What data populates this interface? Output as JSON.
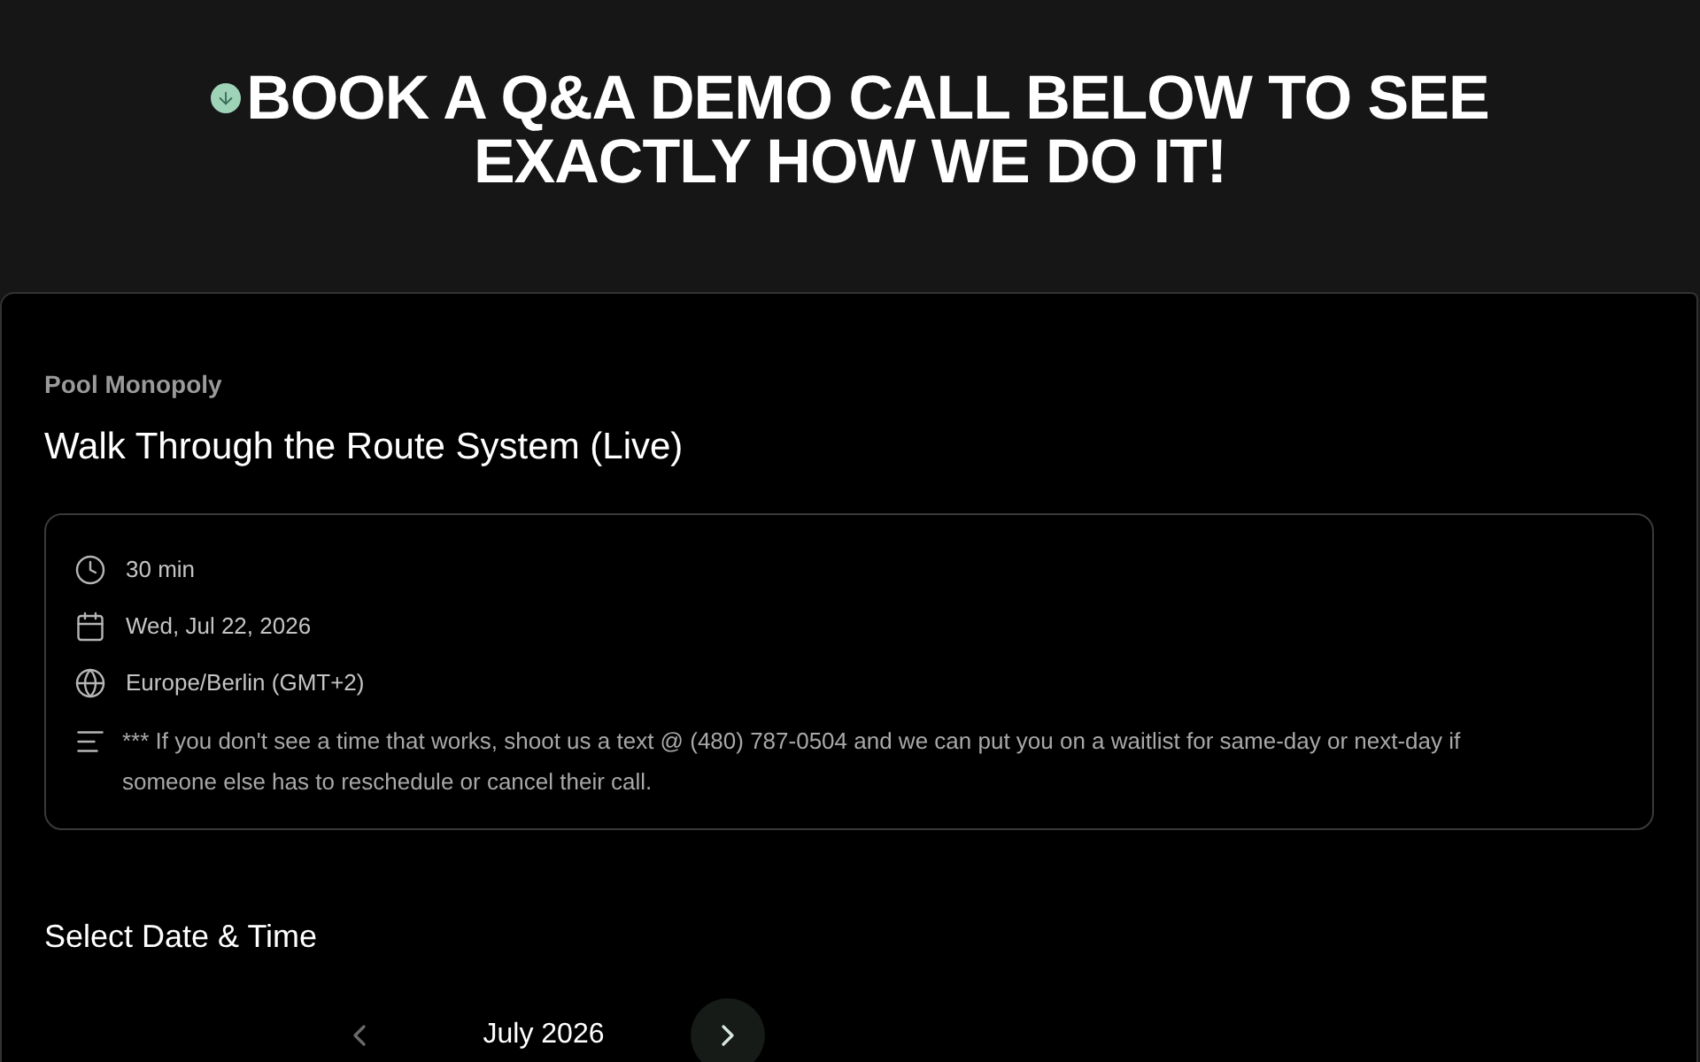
{
  "banner": {
    "heading": "BOOK A Q&A DEMO CALL BELOW TO SEE EXACTLY HOW WE DO IT!"
  },
  "event": {
    "organizer": "Pool Monopoly",
    "title": "Walk Through the Route System (Live)",
    "details": [
      {
        "kind": "duration",
        "text": "30 min"
      },
      {
        "kind": "date",
        "text": "Wed, Jul 22, 2026"
      },
      {
        "kind": "timezone",
        "text": "Europe/Berlin (GMT+2)"
      },
      {
        "kind": "description",
        "text": "*** If you don't see a time that works, shoot us a text @ (480) 787-0504 and we can put you on a waitlist for same-day or next-day if someone else has to reschedule or cancel their call."
      }
    ]
  },
  "scheduler": {
    "heading": "Select Date & Time",
    "month": "July 2026",
    "prev": {
      "disabled": true
    },
    "next": {
      "disabled": false
    }
  }
}
